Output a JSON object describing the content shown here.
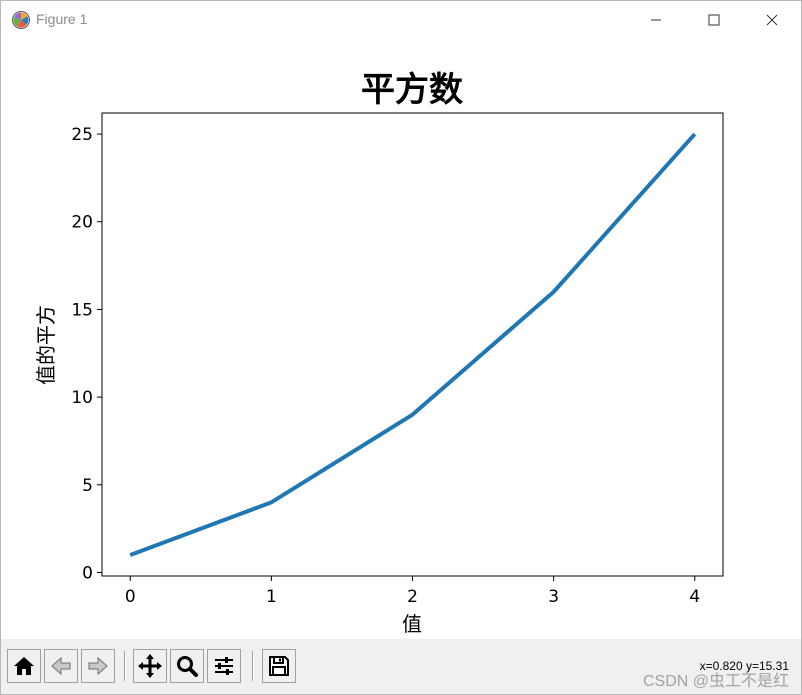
{
  "window": {
    "title": "Figure 1"
  },
  "chart_data": {
    "type": "line",
    "title": "平方数",
    "xlabel": "值",
    "ylabel": "值的平方",
    "x": [
      0,
      1,
      2,
      3,
      4
    ],
    "series": [
      {
        "values": [
          1,
          4,
          9,
          16,
          25
        ],
        "color": "#1f77b4"
      }
    ],
    "xticks": [
      "0",
      "1",
      "2",
      "3",
      "4"
    ],
    "yticks": [
      "0",
      "5",
      "10",
      "15",
      "20",
      "25"
    ],
    "xlim": [
      -0.2,
      4.2
    ],
    "ylim": [
      -0.2,
      26.2
    ],
    "grid": false
  },
  "toolbar": {
    "buttons": [
      {
        "name": "home-button",
        "icon": "home-icon"
      },
      {
        "name": "back-button",
        "icon": "arrow-left-icon"
      },
      {
        "name": "forward-button",
        "icon": "arrow-right-icon"
      },
      {
        "name": "pan-button",
        "icon": "move-icon"
      },
      {
        "name": "zoom-button",
        "icon": "magnifier-icon"
      },
      {
        "name": "configure-subplots-button",
        "icon": "sliders-icon"
      },
      {
        "name": "save-button",
        "icon": "floppy-disk-icon"
      }
    ],
    "coords": "x=0.820 y=15.31"
  },
  "watermark": "CSDN @虫工不是红"
}
